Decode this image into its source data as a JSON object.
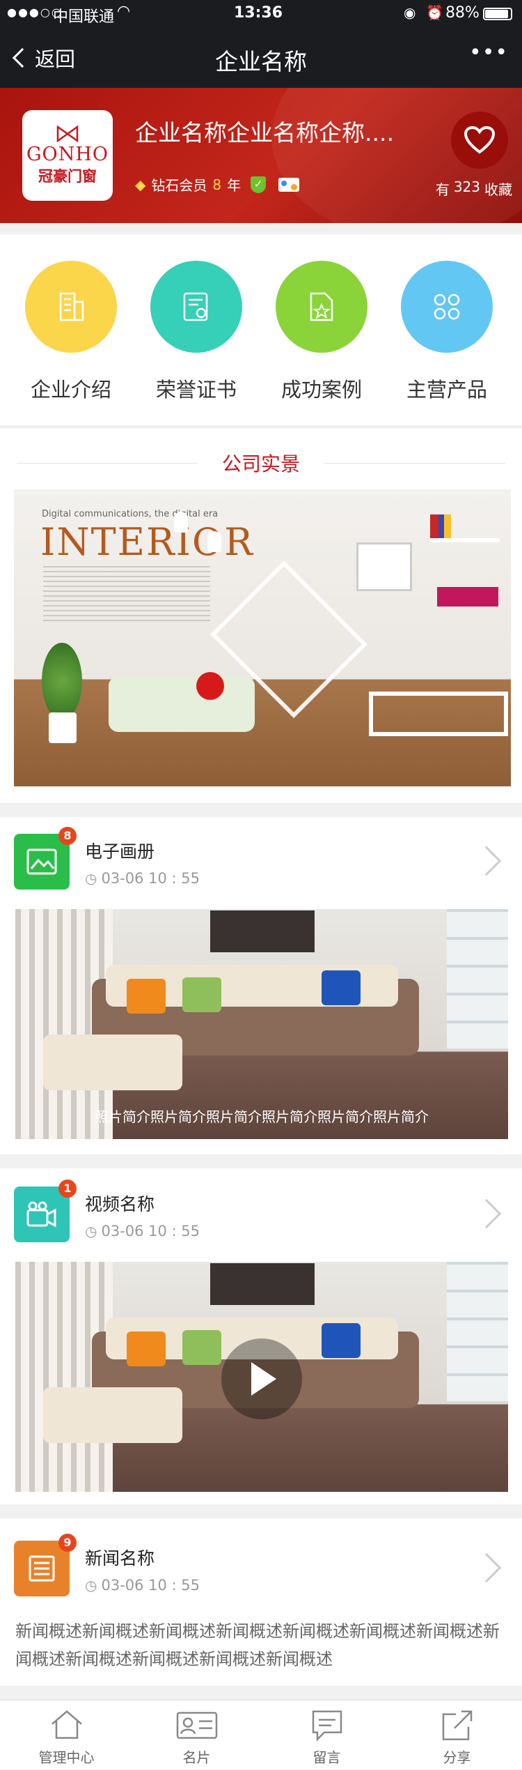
{
  "status_bar": {
    "carrier": "中国联通",
    "time": "13:36",
    "battery": "88%"
  },
  "nav": {
    "back_label": "返回",
    "title": "企业名称",
    "more_label": "•••"
  },
  "company": {
    "logo_en": "GONHO",
    "logo_cn": "冠豪门窗",
    "name": "企业名称企业名称企称....",
    "member_level": "钻石会员",
    "member_years": "8",
    "member_years_unit": "年",
    "favorites_prefix": "有",
    "favorites_count": "323",
    "favorites_suffix": "收藏"
  },
  "categories": [
    {
      "label": "企业介绍",
      "color": "#fbd54a",
      "icon": "building-icon"
    },
    {
      "label": "荣誉证书",
      "color": "#36cfb7",
      "icon": "certificate-icon"
    },
    {
      "label": "成功案例",
      "color": "#8ad43a",
      "icon": "case-file-icon"
    },
    {
      "label": "主营产品",
      "color": "#63c7f3",
      "icon": "product-grid-icon"
    }
  ],
  "showcase": {
    "title": "公司实景",
    "image_text_1": "Digital communications, the digital era",
    "image_text_2": "INTERIOR"
  },
  "feed": [
    {
      "title": "电子画册",
      "time": "03-06 10 : 55",
      "badge": "8",
      "icon": "image-icon",
      "icon_color": "#2bbd4a",
      "caption": "照片简介照片简介照片简介照片简介照片简介照片简介"
    },
    {
      "title": "视频名称",
      "time": "03-06 10 : 55",
      "badge": "1",
      "icon": "video-camera-icon",
      "icon_color": "#2ec4b6"
    },
    {
      "title": "新闻名称",
      "time": "03-06 10 : 55",
      "badge": "9",
      "icon": "news-icon",
      "icon_color": "#e8822a",
      "summary": "新闻概述新闻概述新闻概述新闻概述新闻概述新闻概述新闻概述新闻概述新闻概述新闻概述新闻概述新闻概述"
    }
  ],
  "tabs": [
    {
      "label": "管理中心",
      "icon": "home-icon"
    },
    {
      "label": "名片",
      "icon": "card-icon"
    },
    {
      "label": "留言",
      "icon": "message-icon"
    },
    {
      "label": "分享",
      "icon": "share-icon"
    }
  ],
  "colors": {
    "accent": "#c8161d",
    "header_red": "#b81a12",
    "bar_dark": "#1b1c20"
  }
}
